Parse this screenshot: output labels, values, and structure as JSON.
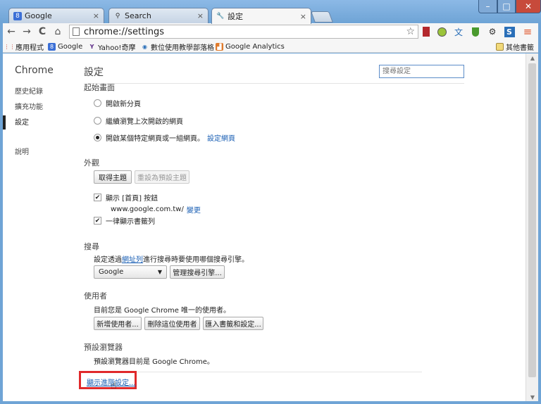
{
  "tabs": [
    {
      "label": "Google",
      "icon": "google-icon",
      "close": "×"
    },
    {
      "label": "Search",
      "icon": "search-icon",
      "close": "×"
    },
    {
      "label": "設定",
      "icon": "wrench-icon",
      "close": "×"
    }
  ],
  "window_controls": {
    "minimize": "–",
    "maximize": "□",
    "close": "✕"
  },
  "toolbar": {
    "url": "chrome://settings",
    "back": "←",
    "forward": "→",
    "reload": "C",
    "home": "⌂",
    "star": "☆",
    "menu": "≡"
  },
  "bookmarks": [
    {
      "label": "應用程式",
      "icon": "apps-icon"
    },
    {
      "label": "Google",
      "icon": "google-icon"
    },
    {
      "label": "Yahoo!奇摩",
      "icon": "yahoo-icon"
    },
    {
      "label": "數位使用教學部落格",
      "icon": "globe-icon"
    },
    {
      "label": "Google Analytics",
      "icon": "analytics-icon"
    }
  ],
  "other_bookmarks": "其他書籤",
  "sidebar": {
    "brand": "Chrome",
    "items": [
      {
        "label": "歷史紀錄"
      },
      {
        "label": "擴充功能"
      },
      {
        "label": "設定"
      },
      {
        "label": "說明"
      }
    ]
  },
  "main": {
    "title": "設定",
    "search_placeholder": "搜尋設定",
    "startup": {
      "title": "起始畫面",
      "options": [
        {
          "label": "開啟新分頁",
          "selected": false
        },
        {
          "label": "繼續瀏覽上次開啟的網頁",
          "selected": false
        },
        {
          "label": "開啟某個特定網頁或一組網頁。",
          "selected": true
        }
      ],
      "set_pages_link": "設定網頁"
    },
    "appearance": {
      "title": "外觀",
      "get_themes": "取得主題",
      "reset_theme": "重設為預設主題",
      "show_home": "顯示 [首頁] 按鈕",
      "home_url": "www.google.com.tw/",
      "change_link": "變更",
      "show_bookmarks_bar": "一律顯示書籤列"
    },
    "search": {
      "title": "搜尋",
      "desc_prefix": "設定透過",
      "desc_link": "網址列",
      "desc_suffix": "進行搜尋時要使用哪個搜尋引擎。",
      "engine": "Google",
      "manage_button": "管理搜尋引擎..."
    },
    "users": {
      "title": "使用者",
      "desc": "目前您是 Google Chrome 唯一的使用者。",
      "add_button": "新增使用者...",
      "delete_button": "刪除這位使用者",
      "import_button": "匯入書籤和設定..."
    },
    "default_browser": {
      "title": "預設瀏覽器",
      "desc": "預設瀏覽器目前是 Google Chrome。"
    },
    "advanced_link": "顯示進階設定..."
  },
  "colors": {
    "highlight_box": "#e0292b",
    "link": "#1a5fb4",
    "frame": "#6fa4d6"
  }
}
